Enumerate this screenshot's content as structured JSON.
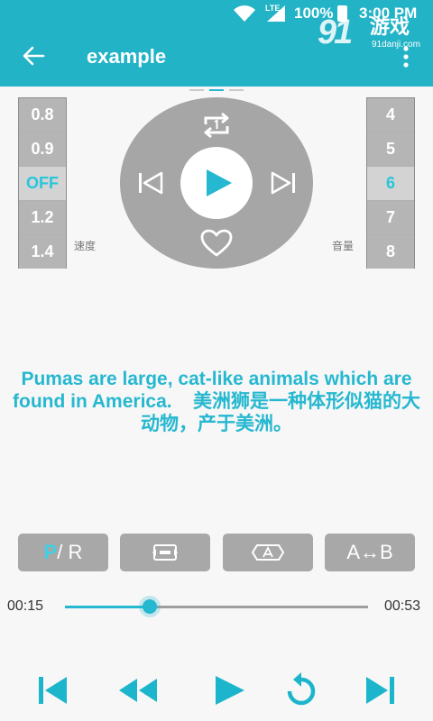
{
  "status_bar": {
    "network": "LTE",
    "battery": "100%",
    "time": "3:00 PM"
  },
  "watermark": {
    "mark": "91",
    "name": "游戏",
    "url": "91danji.com"
  },
  "toolbar": {
    "title": "example"
  },
  "speed": {
    "label": "速度",
    "options": [
      "0.8",
      "0.9",
      "OFF",
      "1.2",
      "1.4"
    ],
    "selected": "OFF"
  },
  "volume": {
    "label": "音量",
    "options": [
      "4",
      "5",
      "6",
      "7",
      "8"
    ],
    "selected": "6"
  },
  "lyrics": {
    "english": "Pumas are large, cat-like animals which are found in America.",
    "chinese": "美洲狮是一种体形似猫的大动物，产于美洲。"
  },
  "modes": {
    "pr_p": "P",
    "pr_rest": " / R",
    "ab": "A↔B"
  },
  "progress": {
    "current": "00:15",
    "total": "00:53",
    "fraction": 0.28
  },
  "colors": {
    "accent": "#22b3c7",
    "highlight": "#26c6da",
    "control_gray": "#a6a6a6"
  }
}
